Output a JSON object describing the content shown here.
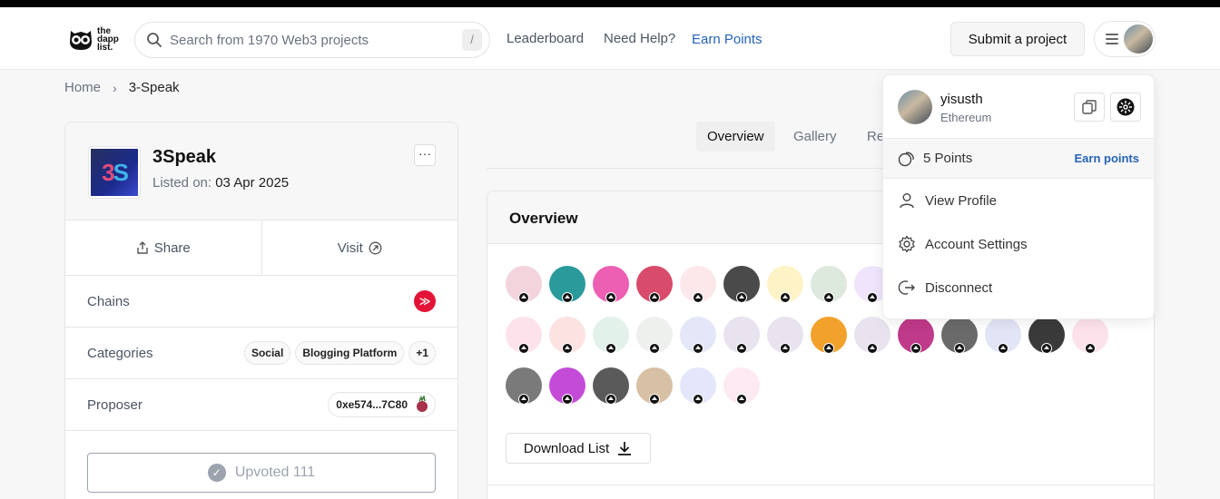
{
  "header": {
    "logo_text": [
      "the",
      "dapp",
      "list."
    ],
    "search_placeholder": "Search from 1970 Web3 projects",
    "search_shortcut": "/",
    "nav": [
      "Leaderboard",
      "Need Help?",
      "Earn Points"
    ],
    "submit_label": "Submit a project"
  },
  "breadcrumb": {
    "home": "Home",
    "current": "3-Speak"
  },
  "project": {
    "name": "3Speak",
    "listed_label": "Listed on:",
    "listed_date": "03 Apr 2025",
    "share_label": "Share",
    "visit_label": "Visit",
    "chains_label": "Chains",
    "categories_label": "Categories",
    "categories": [
      "Social",
      "Blogging Platform",
      "+1"
    ],
    "proposer_label": "Proposer",
    "proposer_address": "0xe574...7C80",
    "upvote_label": "Upvoted 111",
    "logo_colors": {
      "bg": "#1b2a8c",
      "accent1": "#e04c7a",
      "accent2": "#3fb3e8"
    }
  },
  "tabs": [
    "Overview",
    "Gallery",
    "Re"
  ],
  "overview": {
    "title": "Overview",
    "download_label": "Download List",
    "avatar_colors": [
      "#f3d3dc",
      "#2b9a9a",
      "#ec5fb3",
      "#d94b6a",
      "#fce7ea",
      "#4a4a4a",
      "#fdf3c7",
      "#dce9dc",
      "#efe4fb",
      "#fde2ec",
      "#fde2e2",
      "#e2f1ea",
      "#eef0ee",
      "#e4e7f8",
      "#e8e3ef",
      "#e8e3ef",
      "#f2a12b",
      "#e8e3ef",
      "#c03a8a",
      "#6a6a6a",
      "#e2e5f6",
      "#3a3a3a",
      "#fde2ec",
      "#7a7a7a",
      "#c44bd8",
      "#5a5a5a",
      "#d7c0a4",
      "#e4e6fb",
      "#fde9f1"
    ]
  },
  "dropdown": {
    "username": "yisusth",
    "network": "Ethereum",
    "points_text": "5 Points",
    "earn_label": "Earn points",
    "items": [
      "View Profile",
      "Account Settings",
      "Disconnect"
    ]
  },
  "colors": {
    "accent": "#2563b6",
    "chain_hive": "#e31337"
  }
}
